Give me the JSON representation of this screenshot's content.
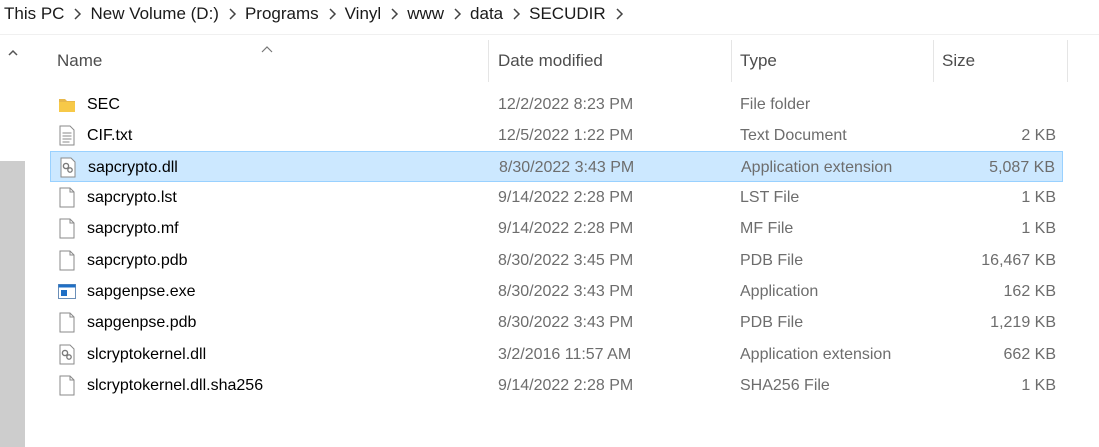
{
  "breadcrumb": [
    "This PC",
    "New Volume (D:)",
    "Programs",
    "Vinyl",
    "www",
    "data",
    "SECUDIR"
  ],
  "columns": {
    "name": "Name",
    "date": "Date modified",
    "type": "Type",
    "size": "Size"
  },
  "sort": {
    "column": "Name",
    "direction": "ascending"
  },
  "selected_row": "sapcrypto.dll",
  "files": [
    {
      "name": "SEC",
      "date": "12/2/2022 8:23 PM",
      "type": "File folder",
      "size": "",
      "icon": "folder-icon"
    },
    {
      "name": "CIF.txt",
      "date": "12/5/2022 1:22 PM",
      "type": "Text Document",
      "size": "2 KB",
      "icon": "text-file-icon"
    },
    {
      "name": "sapcrypto.dll",
      "date": "8/30/2022 3:43 PM",
      "type": "Application extension",
      "size": "5,087 KB",
      "icon": "dll-file-icon"
    },
    {
      "name": "sapcrypto.lst",
      "date": "9/14/2022 2:28 PM",
      "type": "LST File",
      "size": "1 KB",
      "icon": "blank-file-icon"
    },
    {
      "name": "sapcrypto.mf",
      "date": "9/14/2022 2:28 PM",
      "type": "MF File",
      "size": "1 KB",
      "icon": "blank-file-icon"
    },
    {
      "name": "sapcrypto.pdb",
      "date": "8/30/2022 3:45 PM",
      "type": "PDB File",
      "size": "16,467 KB",
      "icon": "blank-file-icon"
    },
    {
      "name": "sapgenpse.exe",
      "date": "8/30/2022 3:43 PM",
      "type": "Application",
      "size": "162 KB",
      "icon": "exe-file-icon"
    },
    {
      "name": "sapgenpse.pdb",
      "date": "8/30/2022 3:43 PM",
      "type": "PDB File",
      "size": "1,219 KB",
      "icon": "blank-file-icon"
    },
    {
      "name": "slcryptokernel.dll",
      "date": "3/2/2016 11:57 AM",
      "type": "Application extension",
      "size": "662 KB",
      "icon": "dll-file-icon"
    },
    {
      "name": "slcryptokernel.dll.sha256",
      "date": "9/14/2022 2:28 PM",
      "type": "SHA256 File",
      "size": "1 KB",
      "icon": "blank-file-icon"
    }
  ]
}
